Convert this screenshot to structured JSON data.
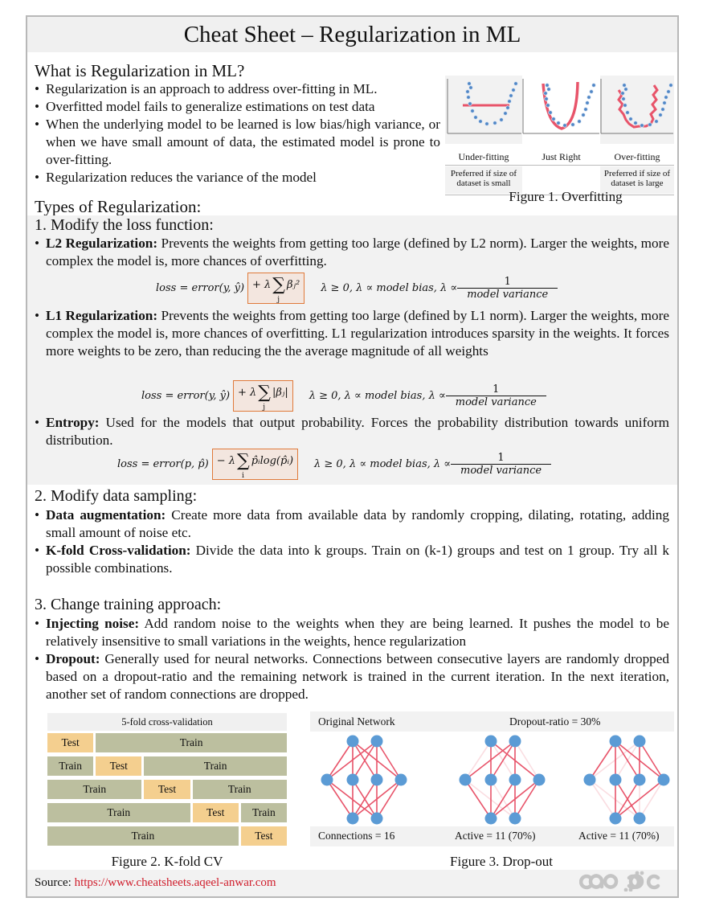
{
  "title": "Cheat Sheet – Regularization in ML",
  "what_is": {
    "heading": "What is Regularization in ML?",
    "bullets": [
      "Regularization is an approach to address over-fitting in ML.",
      "Overfitted model fails to generalize estimations on test data",
      "When the underlying model to be learned is low bias/high variance, or when we have small amount of data, the estimated model is prone to over-fitting.",
      "Regularization reduces the variance of the model"
    ]
  },
  "figure1": {
    "panels": [
      {
        "label": "Under-fitting",
        "note": "Preferred if size of dataset is small"
      },
      {
        "label": "Just Right",
        "note": ""
      },
      {
        "label": "Over-fitting",
        "note": "Preferred if size of dataset is large"
      }
    ],
    "caption": "Figure 1. Overfitting"
  },
  "types_heading": "Types of Regularization:",
  "section1": {
    "heading": "1. Modify the loss function:",
    "items": [
      {
        "term": "L2 Regularization:",
        "text": " Prevents the weights from getting too large (defined by L2 norm). Larger the weights, more complex the model is, more chances of overfitting.",
        "formula": {
          "lhs": "loss = error(y, ŷ)",
          "penalty_prefix": "+ λ",
          "sigma_sub": "j",
          "penalty_term": "βⱼ²",
          "cond": "λ ≥ 0,  λ ∝ model bias,   λ ∝",
          "num": "1",
          "den": "model variance"
        }
      },
      {
        "term": "L1 Regularization:",
        "text": " Prevents the weights from getting too large (defined by L1 norm). Larger the weights, more complex the model is, more chances of overfitting. L1 regularization introduces sparsity in the weights. It forces more weights to be zero, than reducing the the average magnitude of all weights",
        "formula": {
          "lhs": "loss = error(y, ŷ)",
          "penalty_prefix": "+ λ",
          "sigma_sub": "j",
          "penalty_term": "|βⱼ|",
          "cond": "λ ≥ 0,  λ ∝ model bias,   λ ∝",
          "num": "1",
          "den": "model variance"
        }
      },
      {
        "term": "Entropy:",
        "text": " Used for the models that output probability. Forces the probability distribution towards uniform distribution.",
        "formula": {
          "lhs": "loss = error(p, p̂)",
          "penalty_prefix": "− λ",
          "sigma_sub": "i",
          "penalty_term": "p̂ᵢlog(p̂ᵢ)",
          "cond": "λ ≥ 0,  λ ∝ model bias,   λ ∝",
          "num": "1",
          "den": "model variance"
        }
      }
    ]
  },
  "section2": {
    "heading": "2. Modify data sampling:",
    "items": [
      {
        "term": "Data augmentation:",
        "text": " Create more data from available data by randomly cropping, dilating, rotating, adding small amount of noise etc."
      },
      {
        "term": "K-fold Cross-validation:",
        "text": " Divide the data into k groups. Train on (k-1) groups and test on 1 group. Try all k possible combinations."
      }
    ]
  },
  "section3": {
    "heading": "3. Change training approach:",
    "items": [
      {
        "term": "Injecting noise:",
        "text": " Add random noise to the weights when they are being learned. It pushes the model to be relatively insensitive to small variations in the weights, hence regularization"
      },
      {
        "term": "Dropout:",
        "text": " Generally used for neural networks. Connections between consecutive layers are randomly dropped based on a dropout-ratio and the remaining network is trained in the current iteration. In the next iteration, another set of random connections are dropped."
      }
    ]
  },
  "figure2": {
    "title": "5-fold cross-validation",
    "train_label": "Train",
    "test_label": "Test",
    "folds": 5,
    "caption": "Figure 2. K-fold CV"
  },
  "figure3": {
    "left_title": "Original Network",
    "right_title": "Dropout-ratio = 30%",
    "labels": [
      "Connections = 16",
      "Active = 11 (70%)",
      "Active = 11 (70%)"
    ],
    "caption": "Figure 3. Drop-out"
  },
  "footer": {
    "source_label": "Source: ",
    "source_url": "https://www.cheatsheets.aqeel-anwar.com"
  },
  "colors": {
    "accent_red": "#e8546a",
    "node_blue": "#5b9bd5",
    "train": "#bcbf9f",
    "test": "#f4cf8f",
    "formula_box": "#e07a3a",
    "link": "#d0202e"
  }
}
